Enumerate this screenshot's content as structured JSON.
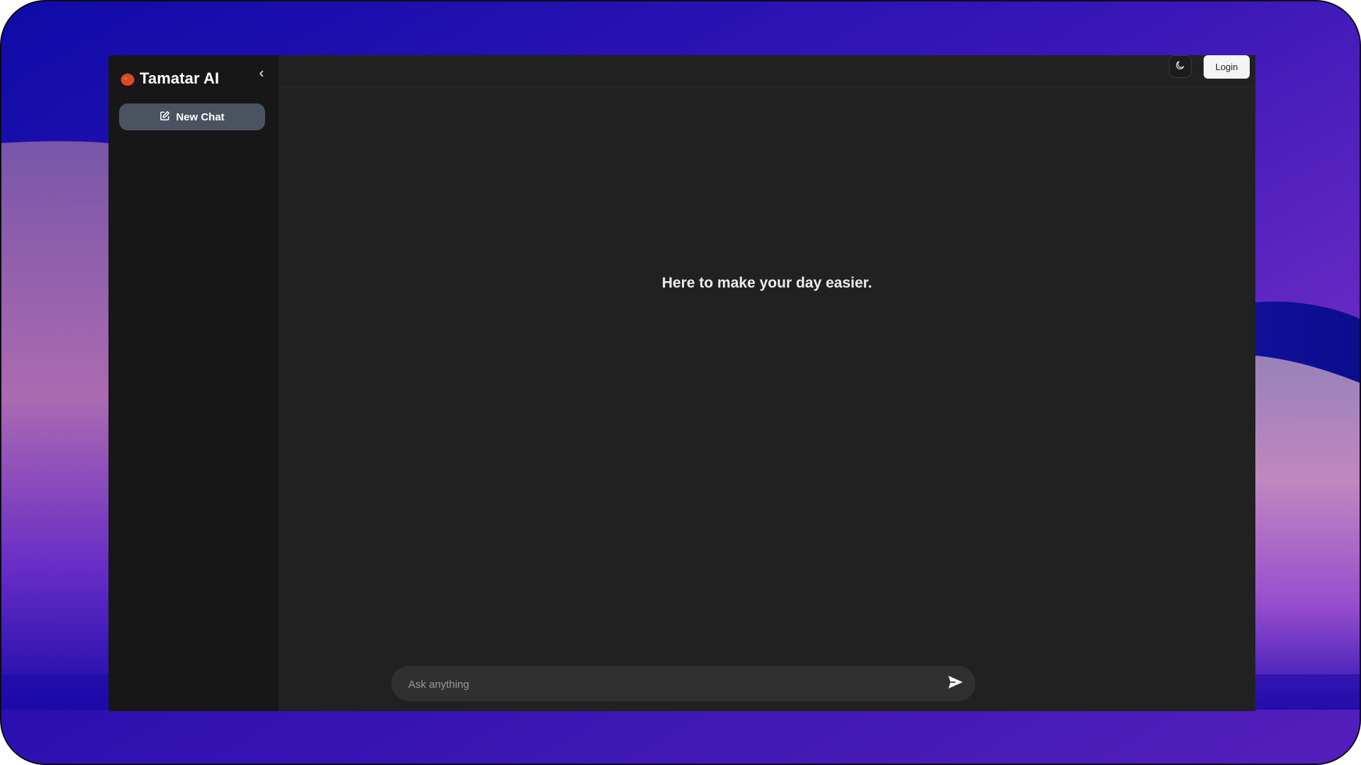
{
  "sidebar": {
    "brand_name": "Tamatar AI",
    "logo_icon": "tomato-icon",
    "collapse_icon": "chevron-left-icon",
    "new_chat_label": "New Chat",
    "new_chat_icon": "edit-icon"
  },
  "topbar": {
    "theme_toggle_icon": "moon-icon",
    "login_label": "Login"
  },
  "main": {
    "hero_text": "Here to make your day easier."
  },
  "composer": {
    "placeholder": "Ask anything",
    "value": "",
    "send_icon": "send-icon"
  },
  "colors": {
    "app_background": "#212121",
    "sidebar_background": "#171717",
    "new_chat_background": "#4b5260",
    "composer_background": "#303030",
    "login_background": "#f3f4f6"
  }
}
